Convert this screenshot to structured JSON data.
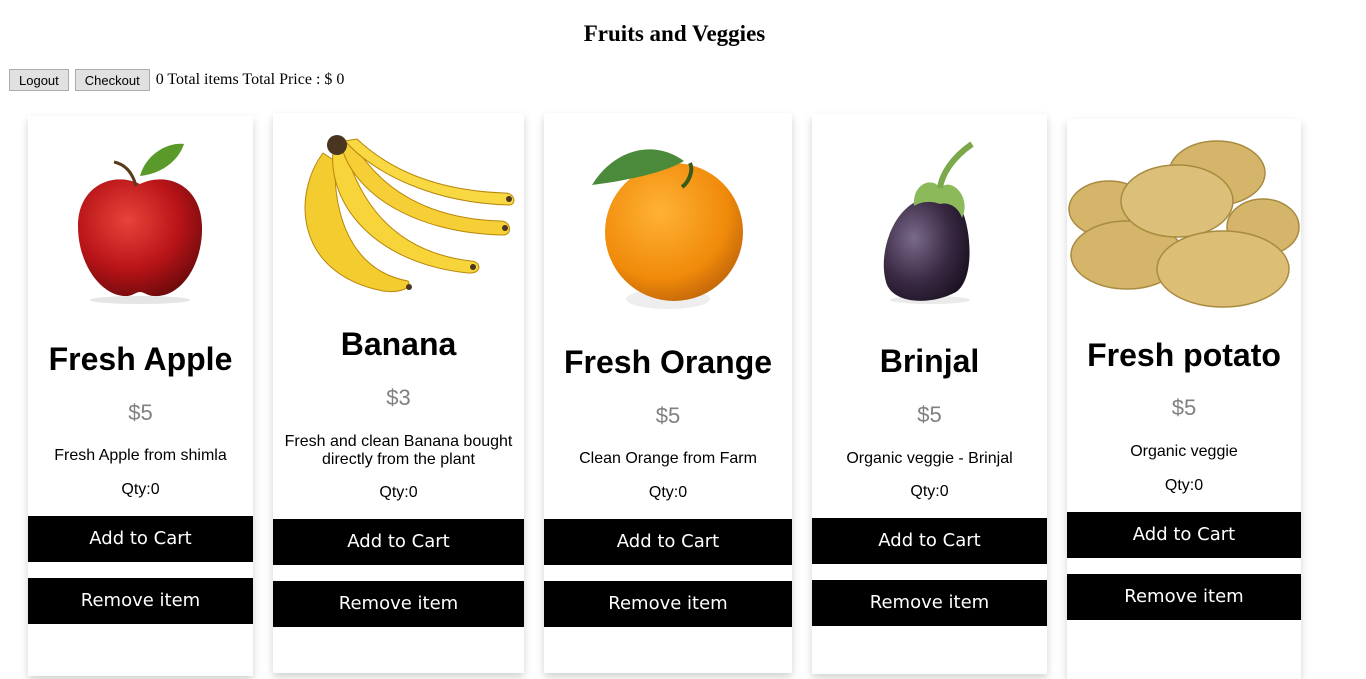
{
  "page": {
    "title": "Fruits and Veggies"
  },
  "toolbar": {
    "logout_label": "Logout",
    "checkout_label": "Checkout",
    "summary": "0 Total items Total Price : $ 0"
  },
  "products": [
    {
      "name": "Fresh Apple",
      "price": "$5",
      "description": "Fresh Apple from shimla",
      "qty": "Qty:0",
      "add_label": "Add to Cart",
      "remove_label": "Remove item",
      "image": "apple-image"
    },
    {
      "name": "Banana",
      "price": "$3",
      "description": "Fresh and clean Banana bought directly from the plant",
      "qty": "Qty:0",
      "add_label": "Add to Cart",
      "remove_label": "Remove item",
      "image": "banana-image"
    },
    {
      "name": "Fresh Orange",
      "price": "$5",
      "description": "Clean Orange from Farm",
      "qty": "Qty:0",
      "add_label": "Add to Cart",
      "remove_label": "Remove item",
      "image": "orange-image"
    },
    {
      "name": "Brinjal",
      "price": "$5",
      "description": "Organic veggie - Brinjal",
      "qty": "Qty:0",
      "add_label": "Add to Cart",
      "remove_label": "Remove item",
      "image": "brinjal-image"
    },
    {
      "name": "Fresh potato",
      "price": "$5",
      "description": "Organic veggie",
      "qty": "Qty:0",
      "add_label": "Add to Cart",
      "remove_label": "Remove item",
      "image": "potato-image"
    }
  ],
  "colors": {
    "button_bg": "#000000",
    "button_text": "#ffffff",
    "price_text": "#808080"
  }
}
